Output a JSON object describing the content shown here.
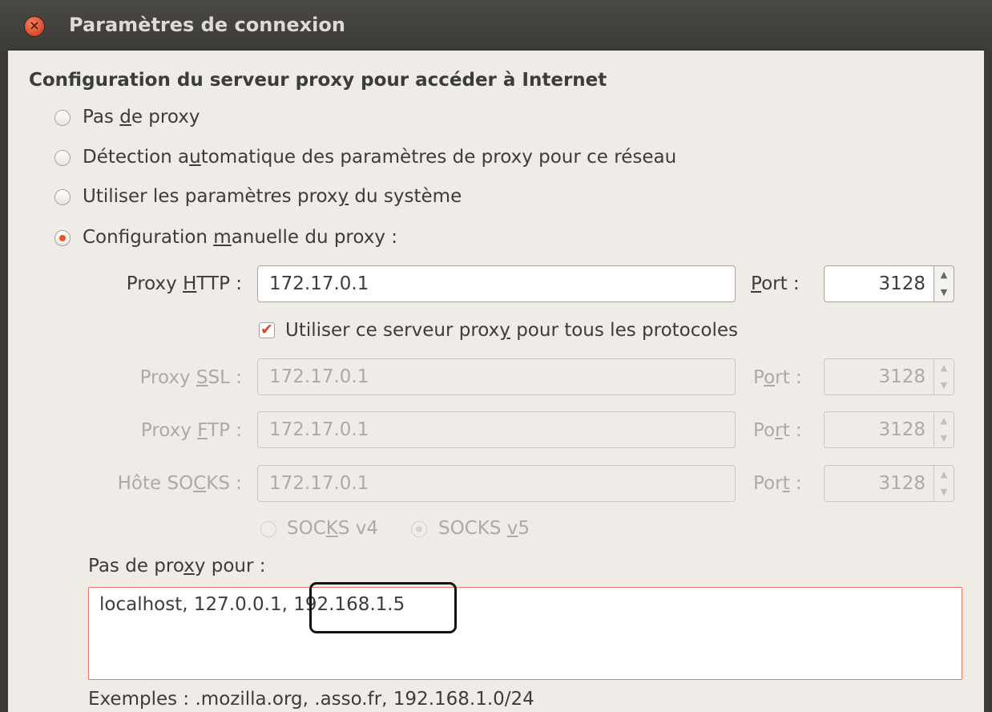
{
  "window": {
    "title": "Paramètres de connexion"
  },
  "section_heading": "Configuration du serveur proxy pour accéder à Internet",
  "options": {
    "no_proxy": {
      "pre": "Pas ",
      "acc": "d",
      "post": "e proxy",
      "selected": false
    },
    "auto_detect": {
      "pre": "Détection a",
      "acc": "u",
      "post": "tomatique des paramètres de proxy pour ce réseau",
      "selected": false
    },
    "system": {
      "pre": "Utiliser les paramètres prox",
      "acc": "y",
      "post": " du système",
      "selected": false
    },
    "manual": {
      "pre": "Configuration ",
      "acc": "m",
      "post": "anuelle du proxy :",
      "selected": true
    }
  },
  "http": {
    "label_pre": "Proxy ",
    "label_acc": "H",
    "label_post": "TTP :",
    "value": "172.17.0.1",
    "port_acc": "P",
    "port_post": "ort :",
    "port": "3128"
  },
  "use_for_all": {
    "pre": "Utiliser ce serveur prox",
    "acc": "y",
    "post": " pour tous les protocoles",
    "checked": true
  },
  "ssl": {
    "label_pre": "Proxy ",
    "label_acc": "S",
    "label_post": "SL :",
    "value": "172.17.0.1",
    "port_pre": "P",
    "port_acc": "o",
    "port_post": "rt :",
    "port": "3128"
  },
  "ftp": {
    "label_pre": "Proxy ",
    "label_acc": "F",
    "label_post": "TP :",
    "value": "172.17.0.1",
    "port_pre": "Po",
    "port_acc": "r",
    "port_post": "t :",
    "port": "3128"
  },
  "socks": {
    "label_pre": "Hôte SO",
    "label_acc": "C",
    "label_post": "KS :",
    "value": "172.17.0.1",
    "port_pre": "Por",
    "port_acc": "t",
    "port_post": " :",
    "port": "3128"
  },
  "socks_versions": {
    "v4": {
      "pre": "SOC",
      "acc": "K",
      "post": "S v4",
      "selected": false
    },
    "v5": {
      "pre": "SOCKS ",
      "acc": "v",
      "post": "5",
      "selected": true
    }
  },
  "no_proxy_for": {
    "pre": "Pas de pro",
    "acc": "x",
    "post": "y pour :",
    "value": "localhost, 127.0.0.1, 192.168.1.5"
  },
  "examples": "Exemples : .mozilla.org, .asso.fr, 192.168.1.0/24",
  "colors": {
    "accent": "#e9542c",
    "titlebar": "#3c3b37",
    "background": "#efebe7"
  }
}
